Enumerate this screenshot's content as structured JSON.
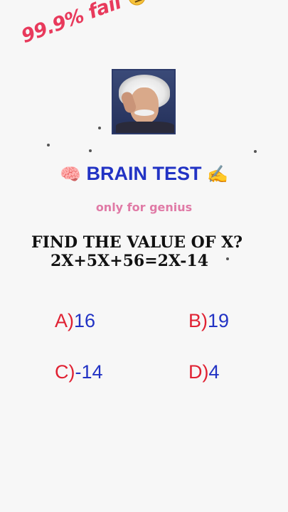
{
  "banner": {
    "text": "99.9% fail",
    "suffix": ".."
  },
  "title": {
    "text": "BRAIN TEST",
    "left_icon": "brain-icon",
    "right_icon": "writing-hand-icon"
  },
  "subtitle": "only for genius",
  "question": {
    "line1": "FIND THE VALUE OF X?",
    "line2": "2X+5X+56=2X-14"
  },
  "options": [
    {
      "letter": "A)",
      "value": "16"
    },
    {
      "letter": "B)",
      "value": "19"
    },
    {
      "letter": "C)",
      "value": "-14"
    },
    {
      "letter": "D)",
      "value": "4"
    }
  ],
  "colors": {
    "banner": "#e83a5c",
    "title": "#2233c4",
    "subtitle": "#e07aa6",
    "option_letter": "#e02233",
    "option_value": "#2233c4"
  }
}
